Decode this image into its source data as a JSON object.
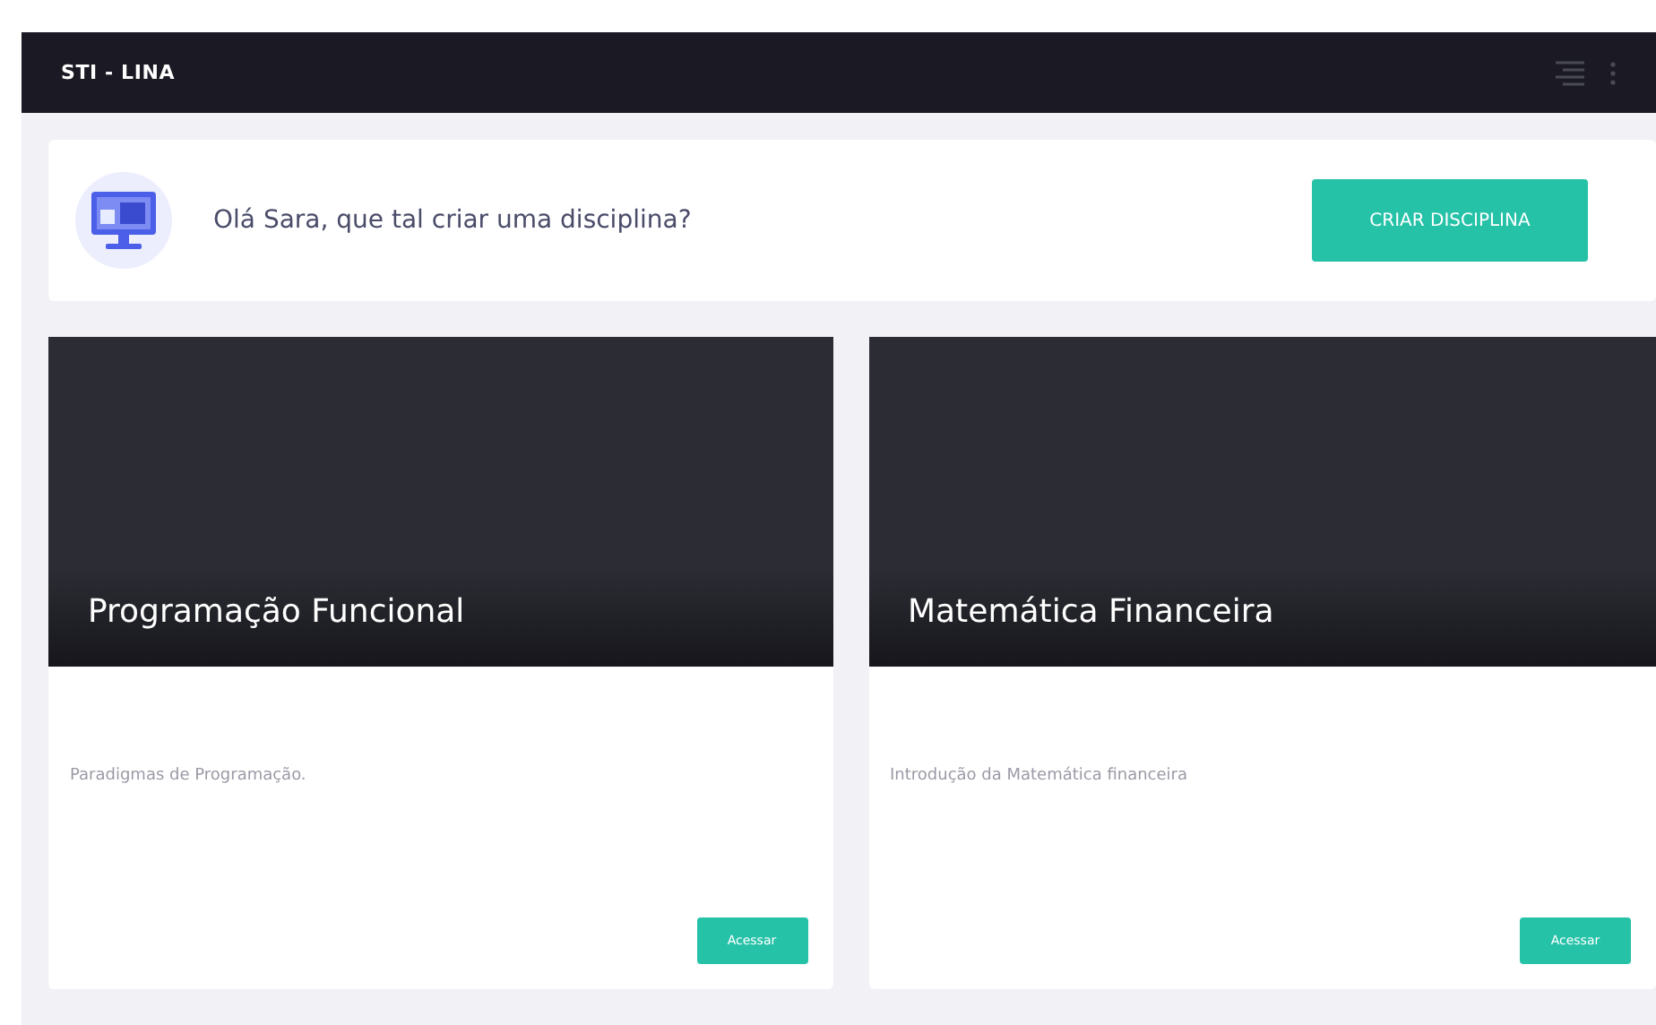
{
  "navbar": {
    "title": "STI - LINA"
  },
  "welcome": {
    "message": "Olá Sara, que tal criar uma disciplina?",
    "button": "CRIAR DISCIPLINA"
  },
  "courses": [
    {
      "title": "Programação Funcional",
      "description": "Paradigmas de Programação.",
      "button": "Acessar"
    },
    {
      "title": "Matemática Financeira",
      "description": "Introdução da Matemática financeira",
      "button": "Acessar"
    }
  ]
}
